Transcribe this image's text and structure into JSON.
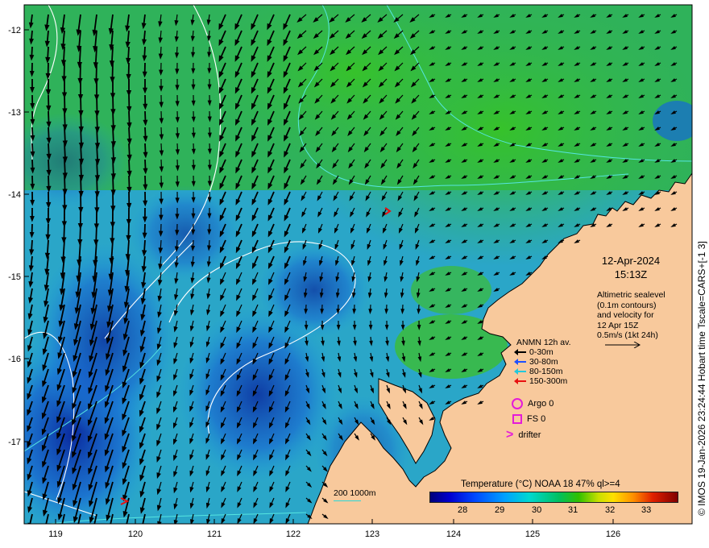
{
  "map": {
    "lat_labels": [
      "-12",
      "-13",
      "-14",
      "-15",
      "-16",
      "-17"
    ],
    "lon_labels": [
      "119",
      "120",
      "121",
      "122",
      "123",
      "124",
      "125",
      "126"
    ],
    "colors": {
      "ocean_warm": "#33b84a",
      "ocean_mid": "#1f9ee0",
      "ocean_cool": "#0b3fb0",
      "land": "#f8c99c",
      "arrow": "#000000",
      "contour": "#ffffff",
      "isobath": "#55e5e0",
      "marker": "#e41bd8"
    }
  },
  "credit": "© IMOS 19-Jan-2026 23:24:44 Hobart time Tscale=CARS+[-1 3]",
  "date": {
    "day": "12-Apr-2024",
    "time": "15:13Z"
  },
  "altimetry_note": [
    "Altimetric sealevel",
    "(0.1m contours)",
    "and velocity for",
    "12 Apr 15Z",
    "0.5m/s (1kt 24h)"
  ],
  "anmn": {
    "title": "ANMN 12h av.",
    "rows": [
      {
        "label": "0-30m",
        "color": "#000000"
      },
      {
        "label": "30-80m",
        "color": "#1e50ff"
      },
      {
        "label": "80-150m",
        "color": "#22c8dc"
      },
      {
        "label": "150-300m",
        "color": "#e81010"
      }
    ]
  },
  "markers": {
    "argo": "Argo 0",
    "fs": "FS 0",
    "drifter": "drifter"
  },
  "colorbar": {
    "title": "Temperature (°C) NOAA 18 47% ql>=4",
    "ticks": [
      "28",
      "29",
      "30",
      "31",
      "32",
      "33"
    ]
  },
  "depth_key": "200  1000m"
}
